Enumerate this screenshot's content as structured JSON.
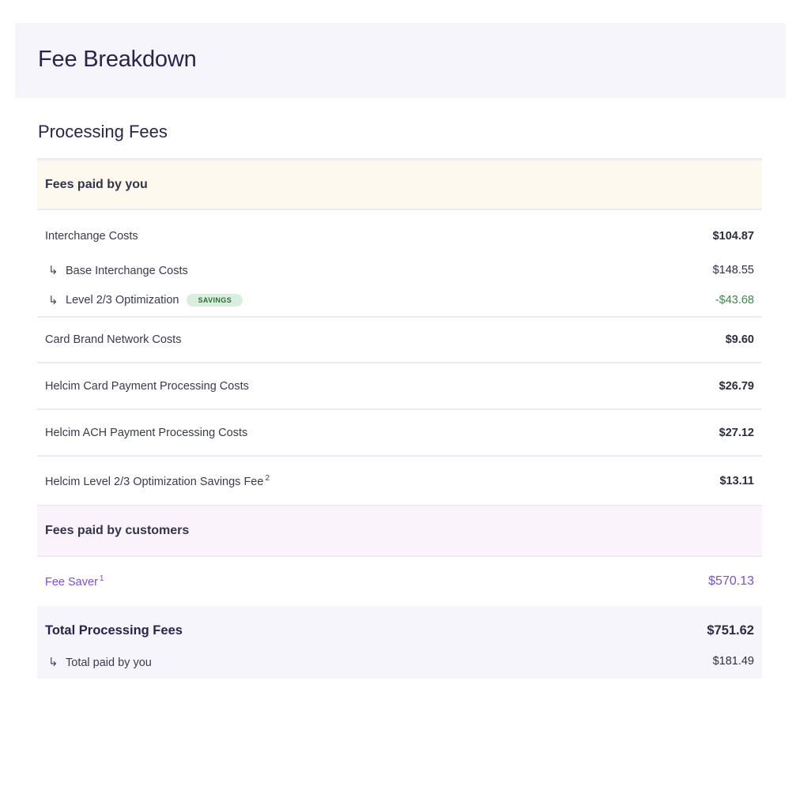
{
  "header": {
    "title": "Fee Breakdown"
  },
  "section": {
    "title": "Processing Fees"
  },
  "groups": {
    "you": {
      "label": "Fees paid by you"
    },
    "customers": {
      "label": "Fees paid by customers"
    }
  },
  "rows": {
    "interchange": {
      "label": "Interchange Costs",
      "amount": "$104.87"
    },
    "base_interchange": {
      "label": "Base Interchange Costs",
      "amount": "$148.55"
    },
    "level23": {
      "label": "Level 2/3 Optimization",
      "badge": "SAVINGS",
      "amount": "-$43.68"
    },
    "card_brand": {
      "label": "Card Brand Network Costs",
      "amount": "$9.60"
    },
    "helcim_card": {
      "label": "Helcim Card Payment Processing Costs",
      "amount": "$26.79"
    },
    "helcim_ach": {
      "label": "Helcim ACH Payment Processing Costs",
      "amount": "$27.12"
    },
    "helcim_level23": {
      "label": "Helcim Level 2/3 Optimization Savings Fee",
      "footnote": "2",
      "amount": "$13.11"
    },
    "fee_saver": {
      "label": "Fee Saver",
      "footnote": "1",
      "amount": "$570.13"
    }
  },
  "total": {
    "label": "Total Processing Fees",
    "amount": "$751.62",
    "paid_by_you_label": "Total paid by you",
    "paid_by_you_amount": "$181.49"
  },
  "icons": {
    "sub_row_arrow": "↳"
  },
  "colors": {
    "savings_green": "#3a8a47",
    "fee_saver_purple": "#7b4fd6",
    "you_header_bg": "#fdf9ef",
    "customers_header_bg": "#faf3fb",
    "page_header_bg": "#f6f5fc"
  }
}
